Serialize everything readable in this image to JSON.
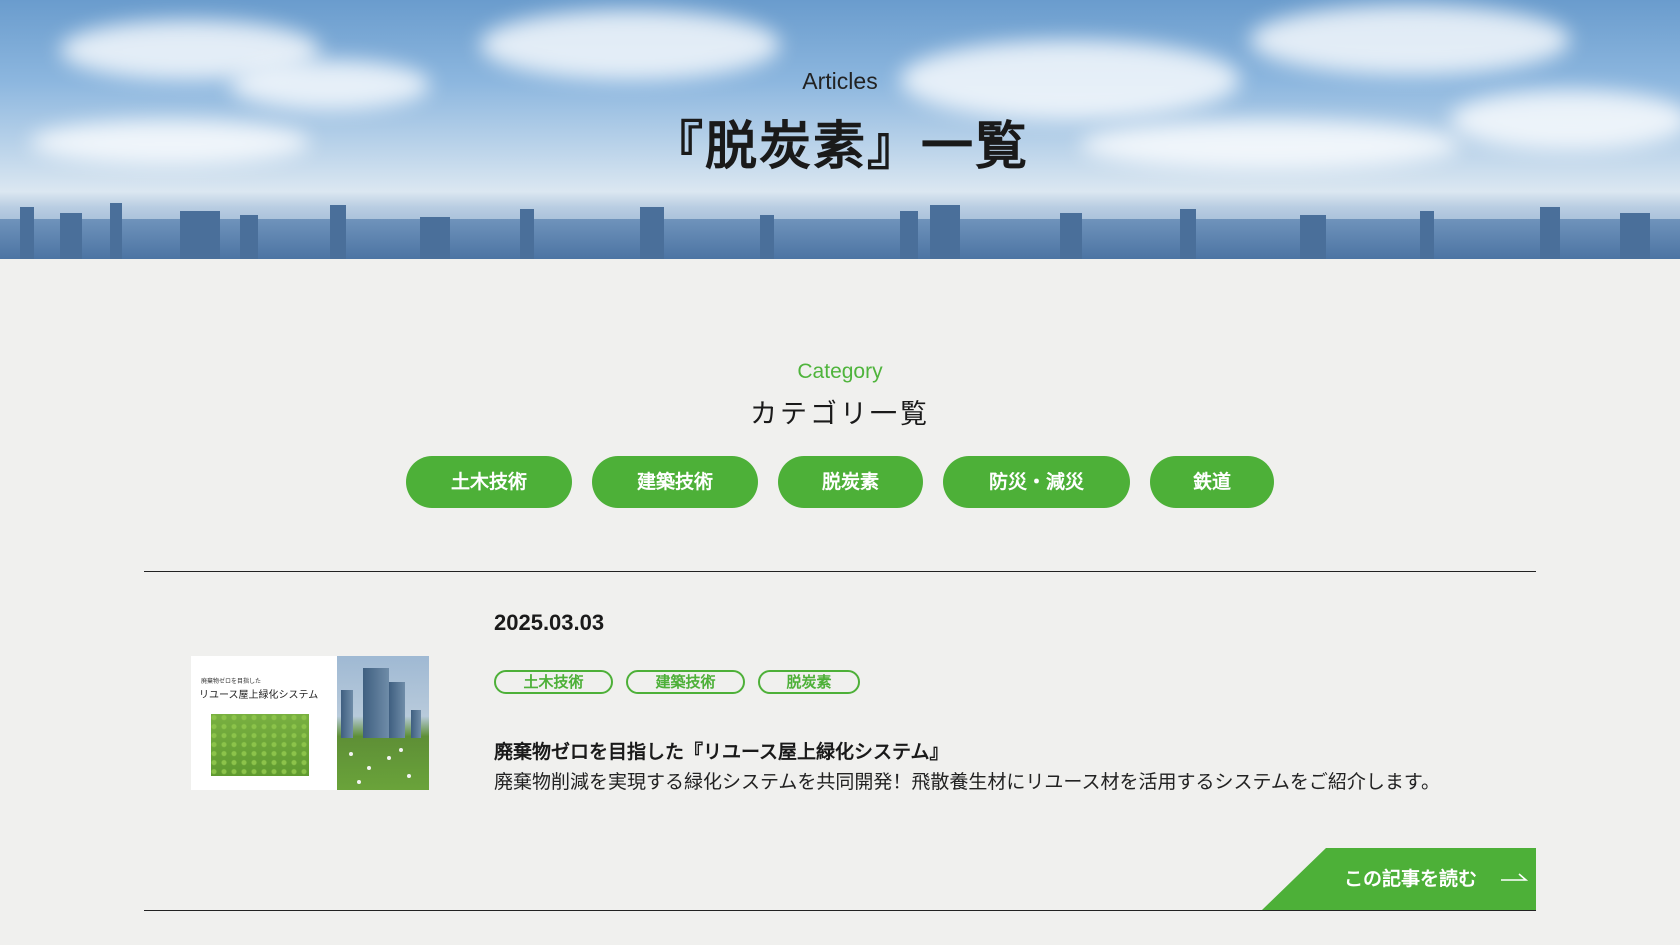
{
  "hero": {
    "subtitle": "Articles",
    "title": "『脱炭素』一覧"
  },
  "category": {
    "label_en": "Category",
    "label_ja": "カテゴリ一覧",
    "items": [
      {
        "label": "土木技術"
      },
      {
        "label": "建築技術"
      },
      {
        "label": "脱炭素"
      },
      {
        "label": "防災・減災"
      },
      {
        "label": "鉄道"
      }
    ]
  },
  "article": {
    "date": "2025.03.03",
    "tags": [
      "土木技術",
      "建築技術",
      "脱炭素"
    ],
    "title": "廃棄物ゼロを目指した『リユース屋上緑化システム』",
    "description": "廃棄物削減を実現する緑化システムを共同開発！飛散養生材にリユース材を活用するシステムをご紹介します。",
    "thumbnail": {
      "small_text": "廃棄物ゼロを目指した",
      "big_text": "リユース屋上緑化システム"
    },
    "read_more": "この記事を読む"
  },
  "colors": {
    "accent": "#4db038",
    "background": "#f0f0ee",
    "text": "#1a1a1a"
  }
}
